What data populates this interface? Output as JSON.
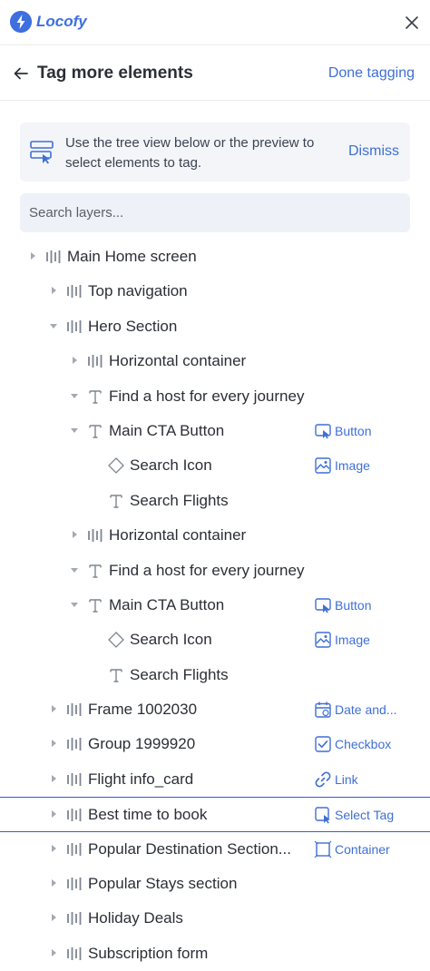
{
  "app": {
    "brand": "Locofy"
  },
  "header": {
    "title": "Tag more elements",
    "done_label": "Done tagging"
  },
  "banner": {
    "text": "Use the tree view below or the preview to select elements to tag.",
    "dismiss_label": "Dismiss"
  },
  "search": {
    "placeholder": "Search layers..."
  },
  "colors": {
    "accent": "#3f6fd6",
    "selected_border": "#2f5fd0"
  },
  "tree": [
    {
      "label": "Main Home screen",
      "icon": "frame-icon",
      "depth": 0,
      "caret": "right"
    },
    {
      "label": "Top navigation",
      "icon": "frame-icon",
      "depth": 1,
      "caret": "right"
    },
    {
      "label": "Hero Section",
      "icon": "frame-icon",
      "depth": 1,
      "caret": "down"
    },
    {
      "label": "Horizontal container",
      "icon": "frame-icon",
      "depth": 2,
      "caret": "right"
    },
    {
      "label": "Find a host for every journey",
      "icon": "text-icon",
      "depth": 2,
      "caret": "down"
    },
    {
      "label": "Main CTA Button",
      "icon": "text-icon",
      "depth": 2,
      "caret": "down",
      "tag": "Button",
      "tag_icon": "button-tag-icon"
    },
    {
      "label": "Search Icon",
      "icon": "diamond-icon",
      "depth": 3,
      "caret": "none",
      "tag": "Image",
      "tag_icon": "image-tag-icon"
    },
    {
      "label": "Search Flights",
      "icon": "text-icon",
      "depth": 3,
      "caret": "none"
    },
    {
      "label": "Horizontal container",
      "icon": "frame-icon",
      "depth": 2,
      "caret": "right"
    },
    {
      "label": "Find a host for every journey",
      "icon": "text-icon",
      "depth": 2,
      "caret": "down"
    },
    {
      "label": "Main CTA Button",
      "icon": "text-icon",
      "depth": 2,
      "caret": "down",
      "tag": "Button",
      "tag_icon": "button-tag-icon"
    },
    {
      "label": "Search Icon",
      "icon": "diamond-icon",
      "depth": 3,
      "caret": "none",
      "tag": "Image",
      "tag_icon": "image-tag-icon"
    },
    {
      "label": "Search Flights",
      "icon": "text-icon",
      "depth": 3,
      "caret": "none"
    },
    {
      "label": "Frame 1002030",
      "icon": "frame-icon",
      "depth": 1,
      "caret": "right",
      "tag": "Date and...",
      "tag_icon": "calendar-tag-icon"
    },
    {
      "label": "Group 1999920",
      "icon": "frame-icon",
      "depth": 1,
      "caret": "right",
      "tag": "Checkbox",
      "tag_icon": "checkbox-tag-icon"
    },
    {
      "label": "Flight info_card",
      "icon": "frame-icon",
      "depth": 1,
      "caret": "right",
      "tag": "Link",
      "tag_icon": "link-tag-icon"
    },
    {
      "label": "Best time to book",
      "icon": "frame-icon",
      "depth": 1,
      "caret": "right",
      "tag": "Select Tag",
      "tag_icon": "select-tag-icon",
      "selected": true
    },
    {
      "label": "Popular Destination Section...",
      "icon": "frame-icon",
      "depth": 1,
      "caret": "right",
      "tag": "Container",
      "tag_icon": "container-tag-icon"
    },
    {
      "label": "Popular Stays section",
      "icon": "frame-icon",
      "depth": 1,
      "caret": "right"
    },
    {
      "label": "Holiday Deals",
      "icon": "frame-icon",
      "depth": 1,
      "caret": "right"
    },
    {
      "label": "Subscription form",
      "icon": "frame-icon",
      "depth": 1,
      "caret": "right"
    }
  ]
}
